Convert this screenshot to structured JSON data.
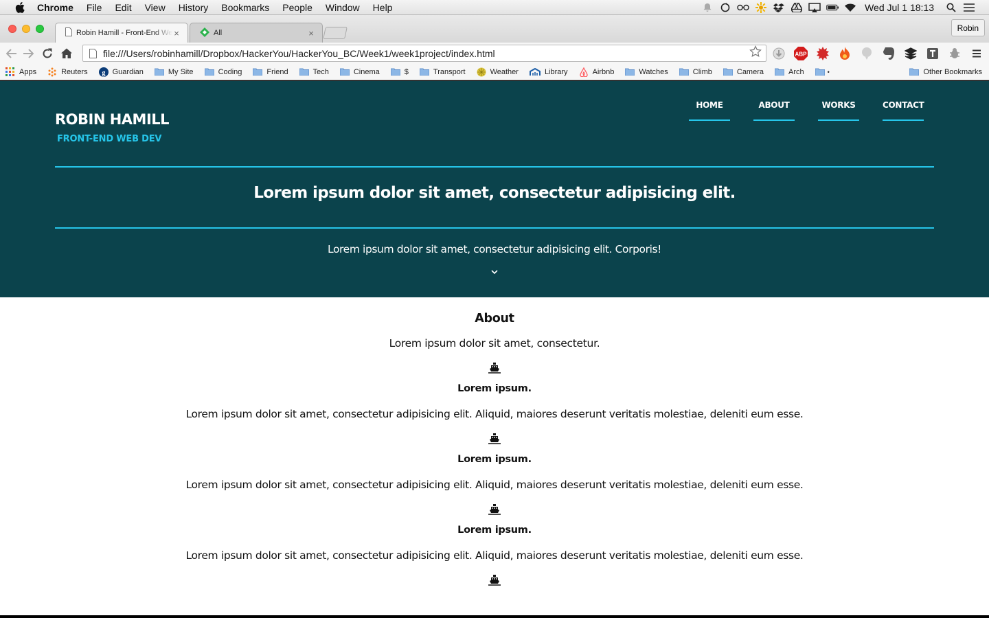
{
  "menubar": {
    "app": "Chrome",
    "items": [
      "File",
      "Edit",
      "View",
      "History",
      "Bookmarks",
      "People",
      "Window",
      "Help"
    ],
    "clock": "Wed Jul 1  18:13"
  },
  "tabs": [
    {
      "title": "Robin Hamill - Front-End Web Dev"
    },
    {
      "title": "All"
    }
  ],
  "profile": "Robin",
  "address": "file:///Users/robinhamill/Dropbox/HackerYou/HackerYou_BC/Week1/week1project/index.html",
  "extensions": {
    "abp": "ABP"
  },
  "bookmarks": [
    "Apps",
    "Reuters",
    "Guardian",
    "My Site",
    "Coding",
    "Friend",
    "Tech",
    "Cinema",
    "$",
    "Transport",
    "Weather",
    "Library",
    "Airbnb",
    "Watches",
    "Climb",
    "Camera",
    "Arch",
    "",
    "Other Bookmarks"
  ],
  "site": {
    "name": "ROBIN HAMILL",
    "tagline": "FRONT-END WEB DEV",
    "nav": [
      "HOME",
      "ABOUT",
      "WORKS",
      "CONTACT"
    ],
    "hero_title": "Lorem ipsum dolor sit amet, consectetur adipisicing elit.",
    "hero_subtitle": "Lorem ipsum dolor sit amet, consectetur adipisicing elit. Corporis!"
  },
  "about": {
    "heading": "About",
    "intro": "Lorem ipsum dolor sit amet, consectetur.",
    "items": [
      {
        "title": "Lorem ipsum.",
        "text": "Lorem ipsum dolor sit amet, consectetur adipisicing elit. Aliquid, maiores deserunt veritatis molestiae, deleniti eum esse."
      },
      {
        "title": "Lorem ipsum.",
        "text": "Lorem ipsum dolor sit amet, consectetur adipisicing elit. Aliquid, maiores deserunt veritatis molestiae, deleniti eum esse."
      },
      {
        "title": "Lorem ipsum.",
        "text": "Lorem ipsum dolor sit amet, consectetur adipisicing elit. Aliquid, maiores deserunt veritatis molestiae, deleniti eum esse."
      }
    ]
  },
  "colors": {
    "hero_bg": "#0b434c",
    "accent": "#26c6ea"
  }
}
